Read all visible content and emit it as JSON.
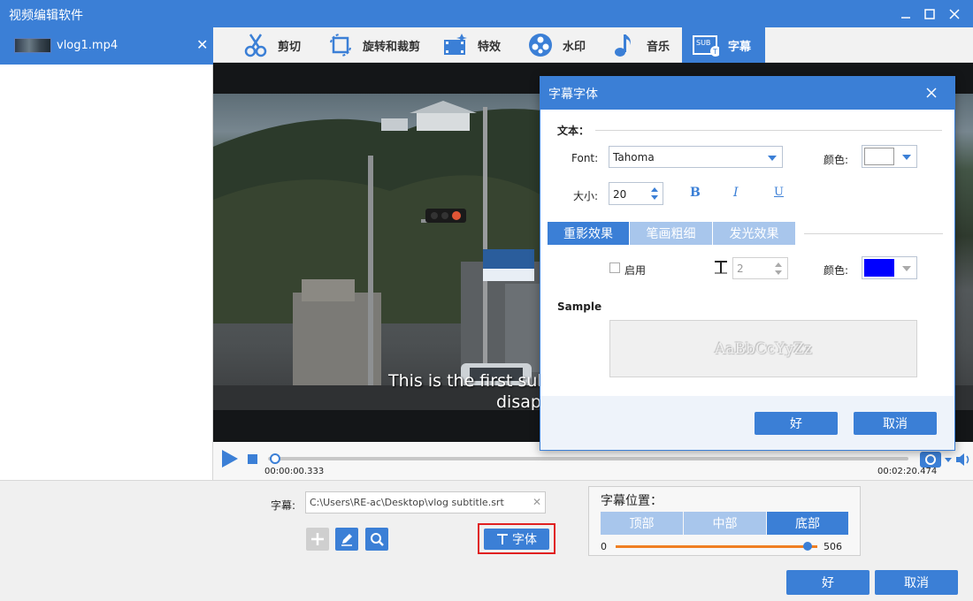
{
  "app": {
    "title": "视频编辑软件"
  },
  "file": {
    "name": "vlog1.mp4",
    "close": "✕"
  },
  "tools": [
    {
      "label": "剪切",
      "icon": "scissors-icon"
    },
    {
      "label": "旋转和裁剪",
      "icon": "rotate-crop-icon"
    },
    {
      "label": "特效",
      "icon": "effects-icon"
    },
    {
      "label": "水印",
      "icon": "watermark-icon"
    },
    {
      "label": "音乐",
      "icon": "music-icon"
    },
    {
      "label": "字幕",
      "icon": "subtitle-icon"
    }
  ],
  "video": {
    "subtitle_line1": "This is the first subt",
    "subtitle_line2": "disapp"
  },
  "player": {
    "current_time": "00:00:00.333",
    "total_time": "00:02:20.474",
    "progress": 0.005
  },
  "bottom": {
    "subtitle_label": "字幕:",
    "subtitle_path": "C:\\Users\\RE-ac\\Desktop\\vlog subtitle.srt",
    "font_button": "字体",
    "position_label": "字幕位置：",
    "position_options": [
      "顶部",
      "中部",
      "底部"
    ],
    "position_selected": "底部",
    "slider_min": "0",
    "slider_max": "506",
    "slider_value": 0.95,
    "ok": "好",
    "cancel": "取消"
  },
  "dialog": {
    "title": "字幕字体",
    "text_section": "文本：",
    "font_label": "Font:",
    "font_value": "Tahoma",
    "color_label": "颜色:",
    "text_color": "#ffffff",
    "size_label": "大小:",
    "size_value": "20",
    "bold": "B",
    "italic": "I",
    "underline": "U",
    "tabs": [
      "重影效果",
      "笔画粗细",
      "发光效果"
    ],
    "active_tab": "重影效果",
    "enable_label": "启用",
    "shadow_value": "2",
    "shadow_color_label": "颜色:",
    "shadow_color": "#0000ff",
    "sample_label": "Sample",
    "sample_text": "AaBbCcYyZz",
    "ok": "好",
    "cancel": "取消"
  },
  "colors": {
    "accent": "#3b7fd6",
    "highlight_border": "#e02020",
    "slider": "#f07f22"
  }
}
